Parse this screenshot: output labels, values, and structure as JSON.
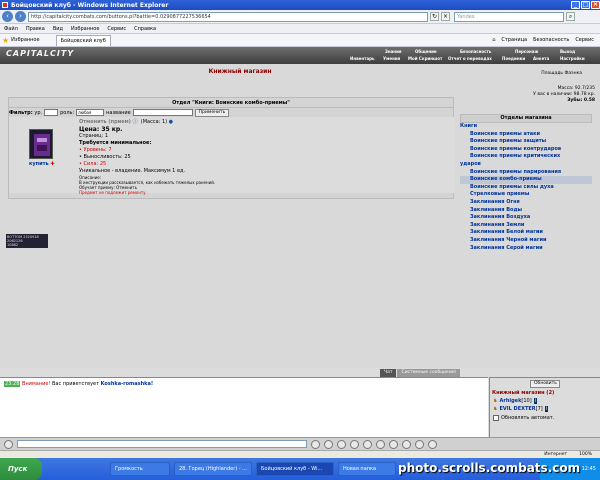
{
  "window": {
    "title": "Бойцовский клуб - Windows Internet Explorer"
  },
  "address": {
    "url": "http://capitalcity.combats.com/buttons.pl?battle=0.0290877227536654",
    "search_placeholder": "Yandex"
  },
  "menu": [
    "Файл",
    "Правка",
    "Вид",
    "Избранное",
    "Сервис",
    "Справка"
  ],
  "favbar": {
    "favorites": "Избранное",
    "tab": "Бойцовский клуб",
    "right": [
      "Страница",
      "Безопасность",
      "Сервис"
    ]
  },
  "site": {
    "logo": "CAPITALCITY",
    "menu_top": [
      "Знания",
      "Общение",
      "Безопасность",
      "Персонаж",
      "Выход"
    ],
    "menu_bottom": [
      "Инвентарь",
      "Умения",
      "Мой Скриншот",
      "Отчет о переводах",
      "Поединки",
      "Анкета",
      "Настройки"
    ]
  },
  "shop": {
    "title": "Книжный магазин",
    "location": "Площадь Фаэнка",
    "mass": "Масса: 92.7/235",
    "money": "У вас в наличии: 98.78 кр.",
    "teeth": "Зубы: 0.58",
    "filter": {
      "label": "Фильтр:",
      "level": "ур.",
      "role": "роль:",
      "role_value": "любая",
      "name": "название",
      "apply": "Применить"
    },
    "section": "Отдел \"Книги: Воинские комбо-приемы\"",
    "item": {
      "name": "Отменить (прием)",
      "mass": "(Масса: 1)",
      "price": "Цена: 35 кр.",
      "pages": "Страниц: 1",
      "req": "Требуется минимальное:",
      "req1": "• Уровень: 7",
      "req2": "• Выносливость: 25",
      "req3": "• Сила: 25",
      "unique": "Уникальное - владение. Максимум 1 ед.",
      "desc_label": "Описание:",
      "desc": "В инструкции рассказывается, как избежать тяжелых ранений.",
      "learns": "Обучает приему: Отменить",
      "repair": "Предмет не подлежит ремонту",
      "buy": "купить"
    },
    "counter": [
      "BOTTOM 2320918",
      "2062126",
      "10882"
    ]
  },
  "departments": {
    "title": "Отделы магазина",
    "items": [
      {
        "label": "Книги",
        "level": 0
      },
      {
        "label": "Воинские приемы атаки",
        "level": 1
      },
      {
        "label": "Воинские приемы защиты",
        "level": 1
      },
      {
        "label": "Воинские приемы контрударов",
        "level": 1
      },
      {
        "label": "Воинские приемы критических",
        "level": 1
      },
      {
        "label": "ударов",
        "level": 0
      },
      {
        "label": "Воинские приемы парирования",
        "level": 1
      },
      {
        "label": "Воинские комбо-приемы",
        "level": 1,
        "selected": true
      },
      {
        "label": "Воинские приемы силы духа",
        "level": 1
      },
      {
        "label": "Стрелковые приемы",
        "level": 1
      },
      {
        "label": "Заклинания Огня",
        "level": 1
      },
      {
        "label": "Заклинания Воды",
        "level": 1
      },
      {
        "label": "Заклинания Воздуха",
        "level": 1
      },
      {
        "label": "Заклинания Земли",
        "level": 1
      },
      {
        "label": "Заклинания Белой магии",
        "level": 1
      },
      {
        "label": "Заклинания Черной магии",
        "level": 1
      },
      {
        "label": "Заклинания Серой магии",
        "level": 1
      }
    ]
  },
  "chat": {
    "tabs": [
      "Чат",
      "Системные сообщения"
    ],
    "time": "23:28",
    "prefix": "Внимание!",
    "text": "Вас приветствует",
    "user": "Koshka-romashka!",
    "refresh": "Обновить",
    "online_title": "Книжный магазин (2)",
    "users": [
      {
        "name": "Arhigek",
        "level": "[10]"
      },
      {
        "name": "EVIL DEXTER",
        "level": "[7]"
      }
    ],
    "auto": "Обновлять автомат."
  },
  "status": {
    "zone": "Интернет",
    "zoom": "100%"
  },
  "taskbar": {
    "start": "Пуск",
    "tasks": [
      "Громкость",
      "28. Горец (Highlander) - ...",
      "Бойцовский клуб - Wi...",
      "Новая папка"
    ],
    "time": "12:45"
  },
  "watermark": "photo.scrolls.combats.com"
}
